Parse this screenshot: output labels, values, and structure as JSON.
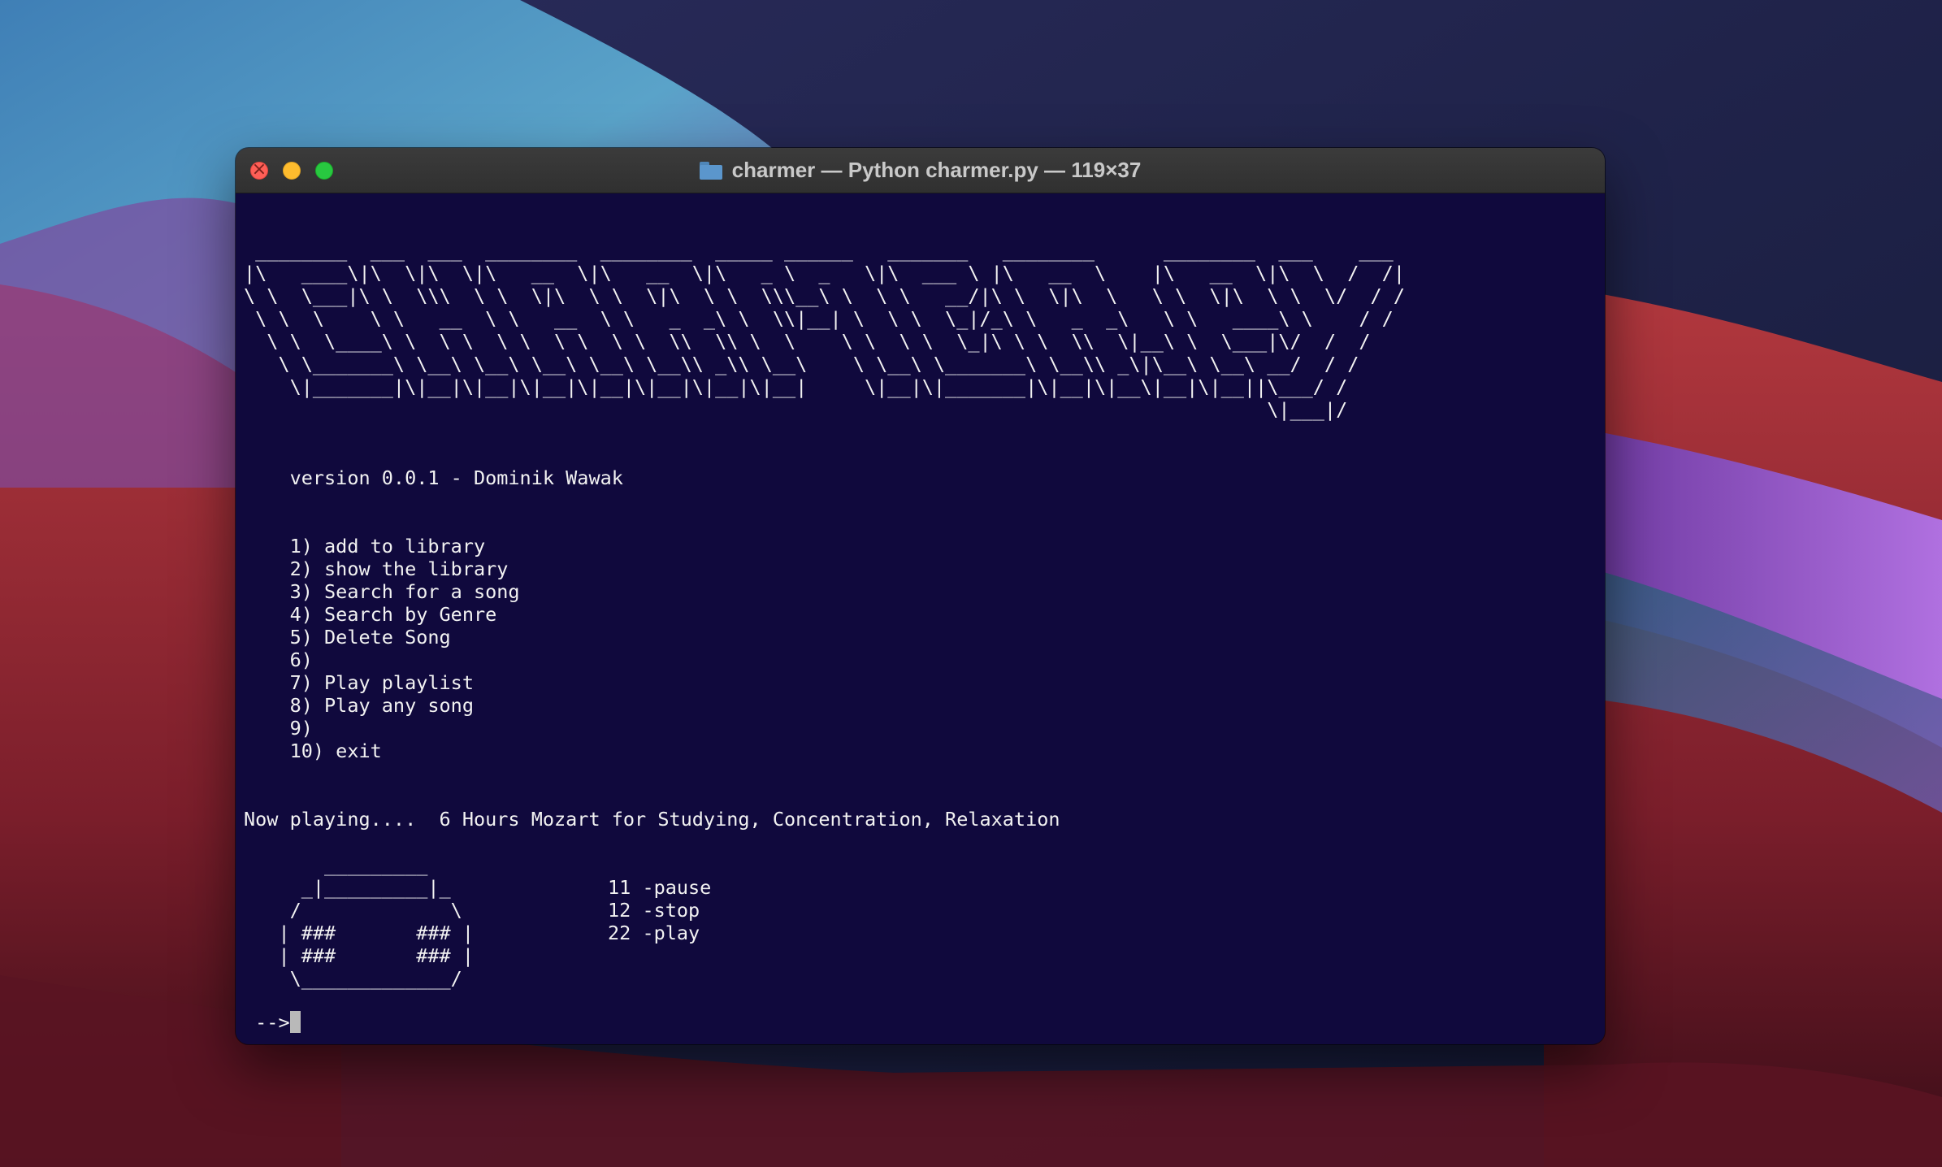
{
  "window": {
    "title": "charmer — Python charmer.py — 119×37",
    "folder_icon": "folder-icon"
  },
  "terminal": {
    "banner_lines": [
      " ________  ___  ___  ________  ________  _____ ______   _______   ________      ________  ___    ___",
      "|\\   ____\\|\\  \\|\\  \\|\\   __  \\|\\   __  \\|\\   _ \\  _   \\|\\  ___ \\ |\\   __  \\    |\\   __  \\|\\  \\  /  /|",
      "\\ \\  \\___|\\ \\  \\\\\\  \\ \\  \\|\\  \\ \\  \\|\\  \\ \\  \\\\\\__\\ \\  \\ \\   __/|\\ \\  \\|\\  \\   \\ \\  \\|\\  \\ \\  \\/  / /",
      " \\ \\  \\    \\ \\   __  \\ \\   __  \\ \\   _  _\\ \\  \\\\|__| \\  \\ \\  \\_|/_\\ \\   _  _\\   \\ \\   ____\\ \\    / /",
      "  \\ \\  \\____\\ \\  \\ \\  \\ \\  \\ \\  \\ \\  \\\\  \\\\ \\  \\    \\ \\  \\ \\  \\_|\\ \\ \\  \\\\  \\|__\\ \\  \\___|\\/  /  /",
      "   \\ \\_______\\ \\__\\ \\__\\ \\__\\ \\__\\ \\__\\\\ _\\\\ \\__\\    \\ \\__\\ \\_______\\ \\__\\\\ _\\|\\__\\ \\__\\ __/  / /",
      "    \\|_______|\\|__|\\|__|\\|__|\\|__|\\|__|\\|__|\\|__|     \\|__|\\|_______|\\|__|\\|__\\|__|\\|__||\\___/ /",
      "                                                                                         \\|___|/"
    ],
    "version": "    version 0.0.1 - Dominik Wawak",
    "menu_items": [
      "    1) add to library",
      "    2) show the library",
      "    3) Search for a song",
      "    4) Search by Genre",
      "    5) Delete Song",
      "    6)",
      "    7) Play playlist",
      "    8) Play any song",
      "    9)",
      "    10) exit"
    ],
    "now_playing": "Now playing....  6 Hours Mozart for Studying, Concentration, Relaxation",
    "radio_art": [
      "       _________",
      "     _|_________|_",
      "    /             \\",
      "   | ###       ### |",
      "   | ###       ### |",
      "    \\_____________/"
    ],
    "controls": [
      "11 -pause",
      "12 -stop",
      "22 -play"
    ],
    "prompt": " -->"
  }
}
